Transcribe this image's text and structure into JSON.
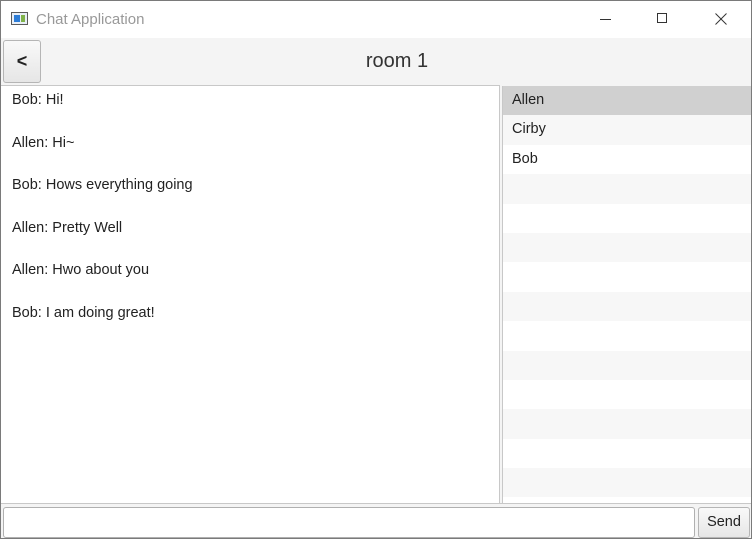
{
  "window": {
    "title": "Chat Application",
    "icon": "app-window-icon"
  },
  "header": {
    "back_label": "<",
    "room_title": "room 1"
  },
  "messages": [
    "Bob: Hi!",
    "Allen: Hi~",
    "Bob: Hows everything going",
    "Allen: Pretty Well",
    "Allen: Hwo about you",
    "Bob: I am doing great!"
  ],
  "users": {
    "items": [
      "Allen",
      "Cirby",
      "Bob"
    ],
    "selected": "Allen"
  },
  "composer": {
    "input_value": "",
    "send_label": "Send"
  },
  "colors": {
    "selected_row": "#d0d0d0",
    "stripe": "#f7f7f7",
    "background": "#f4f4f4"
  }
}
